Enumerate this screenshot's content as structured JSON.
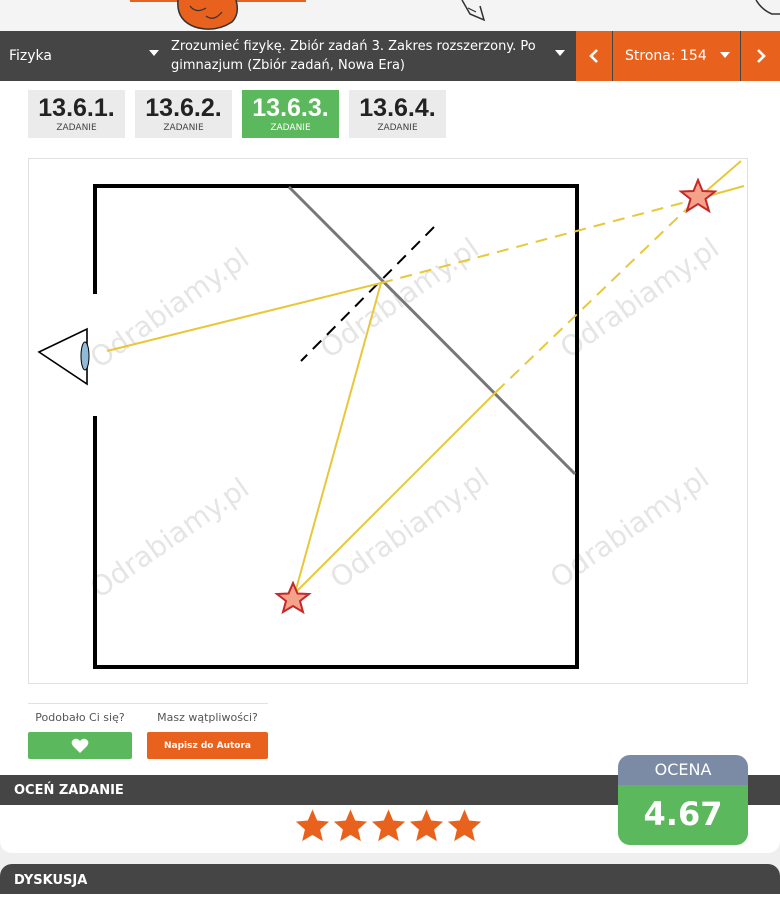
{
  "nav": {
    "subject": "Fizyka",
    "book": "Zrozumieć fizykę. Zbiór zadań 3. Zakres rozszerzony. Po gimnazjum (Zbiór zadań, Nowa Era)",
    "page": "Strona: 154"
  },
  "tasks": [
    {
      "number": "13.6.1.",
      "label": "ZADANIE",
      "active": false
    },
    {
      "number": "13.6.2.",
      "label": "ZADANIE",
      "active": false
    },
    {
      "number": "13.6.3.",
      "label": "ZADANIE",
      "active": true
    },
    {
      "number": "13.6.4.",
      "label": "ZADANIE",
      "active": false
    }
  ],
  "figure": {
    "watermark": "Odrabiamy.pl"
  },
  "feedback": {
    "like_question": "Podobało Ci się?",
    "doubt_question": "Masz wątpliwości?",
    "author_button": "Napisz do Autora"
  },
  "rating": {
    "section_title": "OCEŃ ZADANIE",
    "score_label": "OCENA",
    "score_value": "4.67",
    "stars": 5
  },
  "discussion": {
    "section_title": "DYSKUSJA"
  },
  "colors": {
    "accent_orange": "#e8621e",
    "green": "#5cb85c",
    "dark_bar": "#454545",
    "ray_yellow": "#e8c73a"
  }
}
